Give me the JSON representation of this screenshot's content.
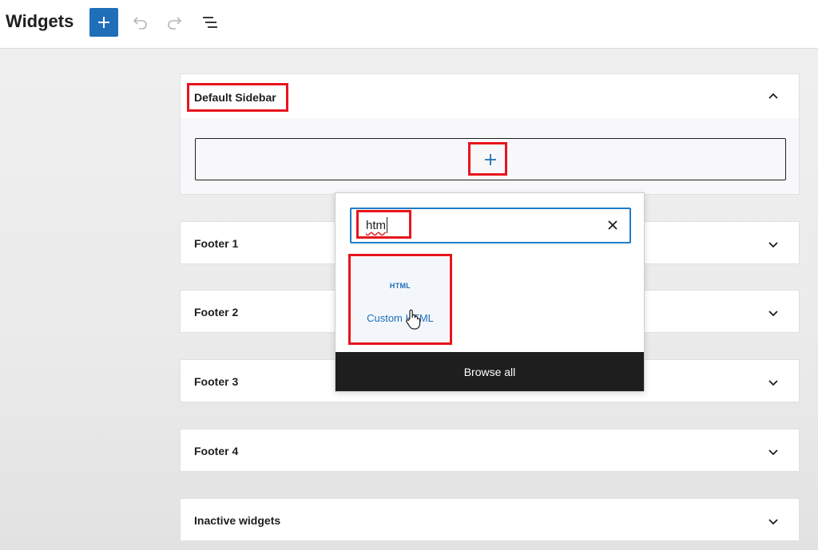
{
  "header": {
    "title": "Widgets",
    "add_block_icon": "plus-icon",
    "undo_icon": "undo-icon",
    "redo_icon": "redo-icon",
    "list_view_icon": "list-view-icon"
  },
  "panels": [
    {
      "label": "Default Sidebar",
      "expanded": true
    },
    {
      "label": "Footer 1",
      "expanded": false
    },
    {
      "label": "Footer 2",
      "expanded": false
    },
    {
      "label": "Footer 3",
      "expanded": false
    },
    {
      "label": "Footer 4",
      "expanded": false
    },
    {
      "label": "Inactive widgets",
      "expanded": false
    }
  ],
  "inserter": {
    "search_value": "htm",
    "clear_icon": "close-icon",
    "results": [
      {
        "icon_text": "HTML",
        "label": "Custom HTML"
      }
    ],
    "browse_all_label": "Browse all"
  },
  "colors": {
    "accent": "#1e6fb8",
    "highlight": "#e8141c",
    "dark": "#1e1e1e"
  }
}
